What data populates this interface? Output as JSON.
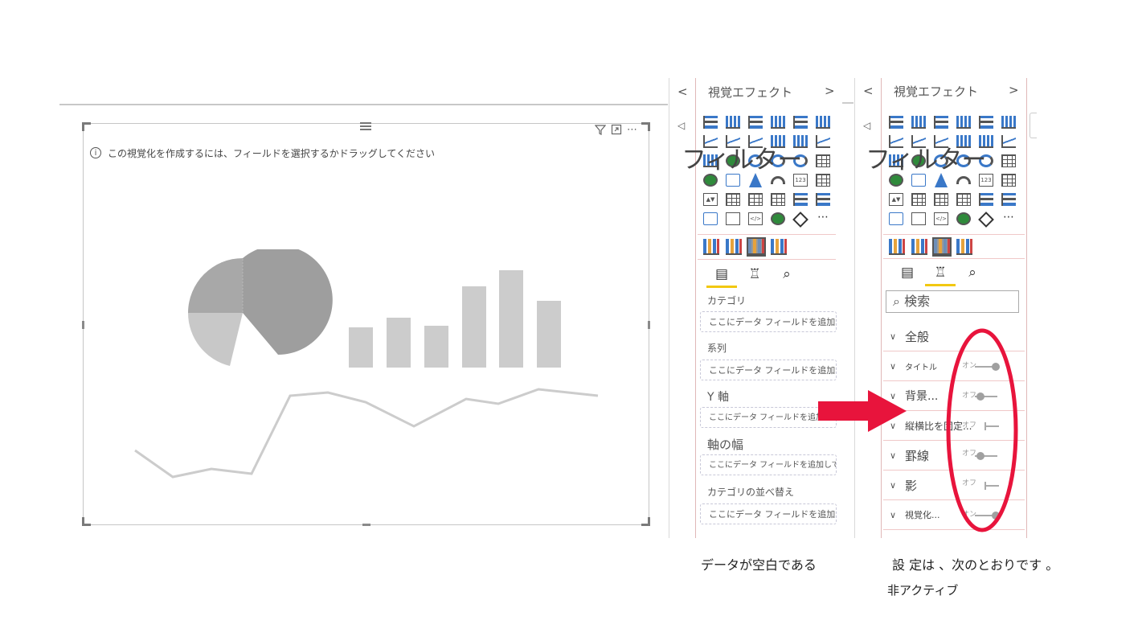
{
  "canvas": {
    "info_message": "この視覚化を作成するには、フィールドを選択するかドラッグしてください",
    "info_icon": "info-icon",
    "tools": {
      "filter_icon": "filter-icon",
      "focus_icon": "focus-mode-icon",
      "more": "⋯"
    },
    "placeholder_colors": {
      "pie_dark": "#9e9e9e",
      "pie_light": "#c8c8c8",
      "bars": "#cccccc",
      "line": "#cccccc"
    }
  },
  "left_panel": {
    "title": "視覚エフェクト",
    "filter_overlay": "フィルター",
    "wells": [
      {
        "label": "カテゴリ",
        "placeholder": "ここにデータ フィールドを追加してください"
      },
      {
        "label": "系列",
        "placeholder": "ここにデータ フィールドを追加してください"
      },
      {
        "label": "Y 軸",
        "placeholder": "ここにデータ フィールドを追加してください"
      },
      {
        "label": "軸の幅",
        "placeholder": "ここにデータ フィールドを追加してください"
      },
      {
        "label": "カテゴリの並べ替え",
        "placeholder": "ここにデータ フィールドを追加してください"
      }
    ],
    "caption": "データが空白である"
  },
  "right_panel": {
    "title": "視覚エフェクト",
    "filter_overlay": "フィルター",
    "search_placeholder": "検索",
    "sections": [
      {
        "label": "全般",
        "toggle": ""
      },
      {
        "label": "タイトル",
        "toggle": "オン"
      },
      {
        "label": "背景...",
        "toggle": "オフ"
      },
      {
        "label": "縦横比を固定...",
        "toggle": "オフ"
      },
      {
        "label": "罫線",
        "toggle": "オフ"
      },
      {
        "label": "影",
        "toggle": "オフ"
      },
      {
        "label": "視覚化...",
        "toggle": "オン"
      }
    ],
    "caption_line1": "設 定は 、次のとおりです 。",
    "caption_line2": "非アクティブ",
    "highlight_color": "#e8143c"
  },
  "arrow_color": "#e8143c",
  "accent_color": "#f2c811"
}
